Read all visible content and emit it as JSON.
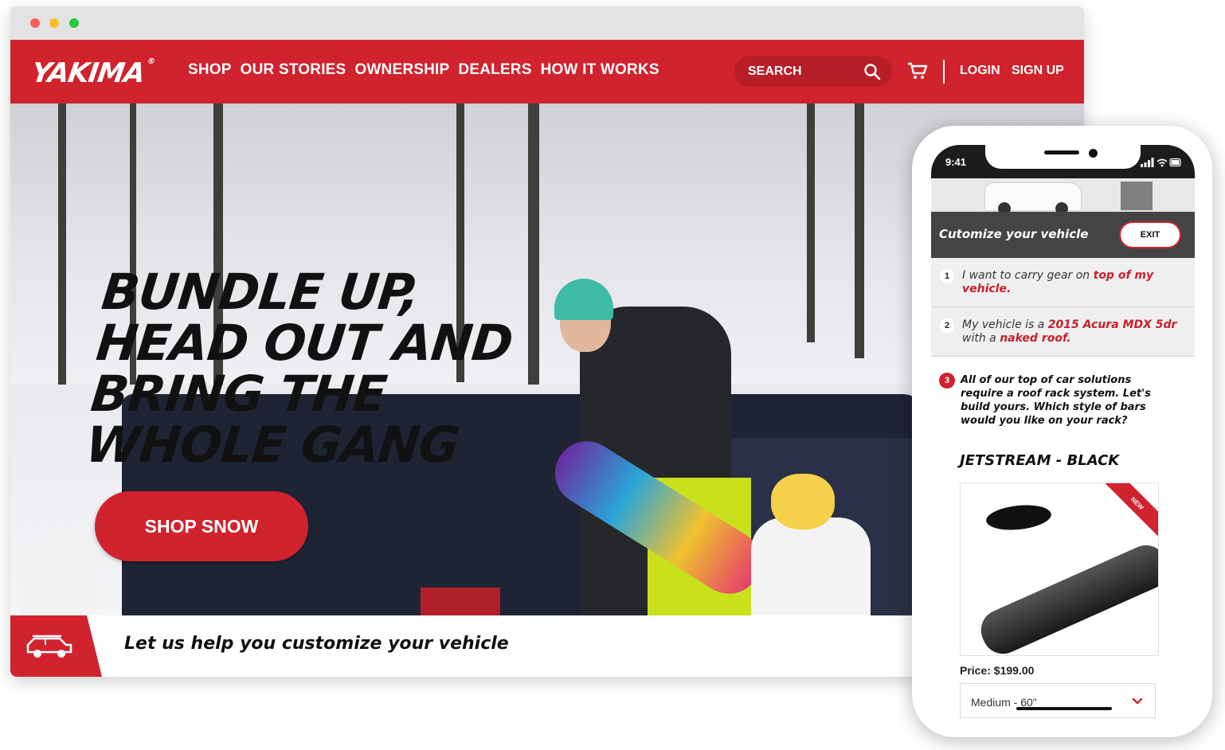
{
  "desktop": {
    "logo": "YAKIMA",
    "nav_links": [
      "SHOP",
      "OUR STORIES",
      "OWNERSHIP",
      "DEALERS",
      "HOW IT WORKS"
    ],
    "search_placeholder": "SEARCH",
    "login_label": "LOGIN",
    "signup_label": "SIGN UP",
    "headline": [
      "BUNDLE UP,",
      "HEAD OUT AND",
      "BRING THE",
      "WHOLE GANG"
    ],
    "cta_label": "SHOP SNOW",
    "customize_text": "Let us help you customize your vehicle",
    "colors": {
      "brand_red": "#d0232e",
      "dark": "#111111"
    },
    "icons": [
      "search-icon",
      "cart-icon",
      "car-icon"
    ]
  },
  "mobile": {
    "time": "9:41",
    "header_title": "Cutomize your vehicle",
    "exit_label": "EXIT",
    "step1": {
      "num": "1",
      "text": "I want to carry gear on ",
      "highlight": "top of my vehicle."
    },
    "step2": {
      "num": "2",
      "text_a": "My vehicle is a ",
      "highlight_a": "2015 Acura MDX 5dr",
      "text_b": " with a ",
      "highlight_b": "naked roof."
    },
    "step3": {
      "num": "3",
      "text": "All of our top of car solutions require a roof rack system. Let's build yours. Which style of bars would you like on your rack?"
    },
    "product_title": "JETSTREAM - BLACK",
    "ribbon": "NEW",
    "price": "Price: $199.00",
    "size_selected": "Medium - 60\""
  }
}
